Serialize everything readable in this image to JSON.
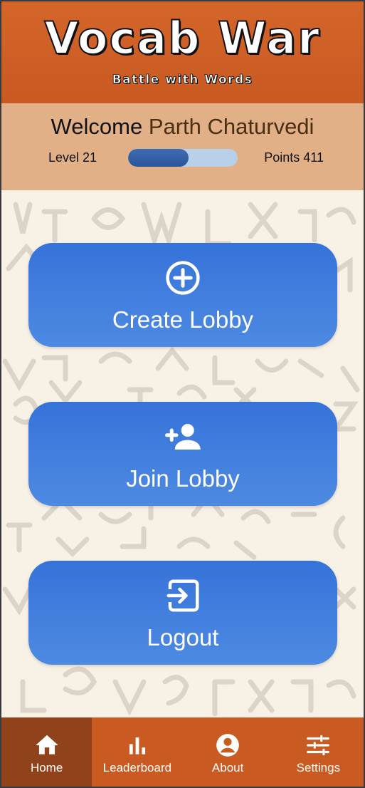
{
  "header": {
    "title": "Vocab War",
    "subtitle": "Battle with Words"
  },
  "welcome": {
    "greeting": "Welcome",
    "user_name": "Parth Chaturvedi",
    "level_label": "Level 21",
    "points_label": "Points 411",
    "progress_fraction": 0.55
  },
  "actions": [
    {
      "label": "Create Lobby",
      "icon": "add-circle-icon"
    },
    {
      "label": "Join Lobby",
      "icon": "person-add-icon"
    },
    {
      "label": "Logout",
      "icon": "logout-icon"
    }
  ],
  "nav": {
    "items": [
      {
        "label": "Home",
        "icon": "home-icon",
        "active": true
      },
      {
        "label": "Leaderboard",
        "icon": "leaderboard-icon",
        "active": false
      },
      {
        "label": "About",
        "icon": "account-circle-icon",
        "active": false
      },
      {
        "label": "Settings",
        "icon": "tune-icon",
        "active": false
      }
    ]
  },
  "colors": {
    "header": "#c85a22",
    "welcome_panel": "#e1b086",
    "button": "#3d7ddb",
    "nav_active": "#90431a"
  }
}
